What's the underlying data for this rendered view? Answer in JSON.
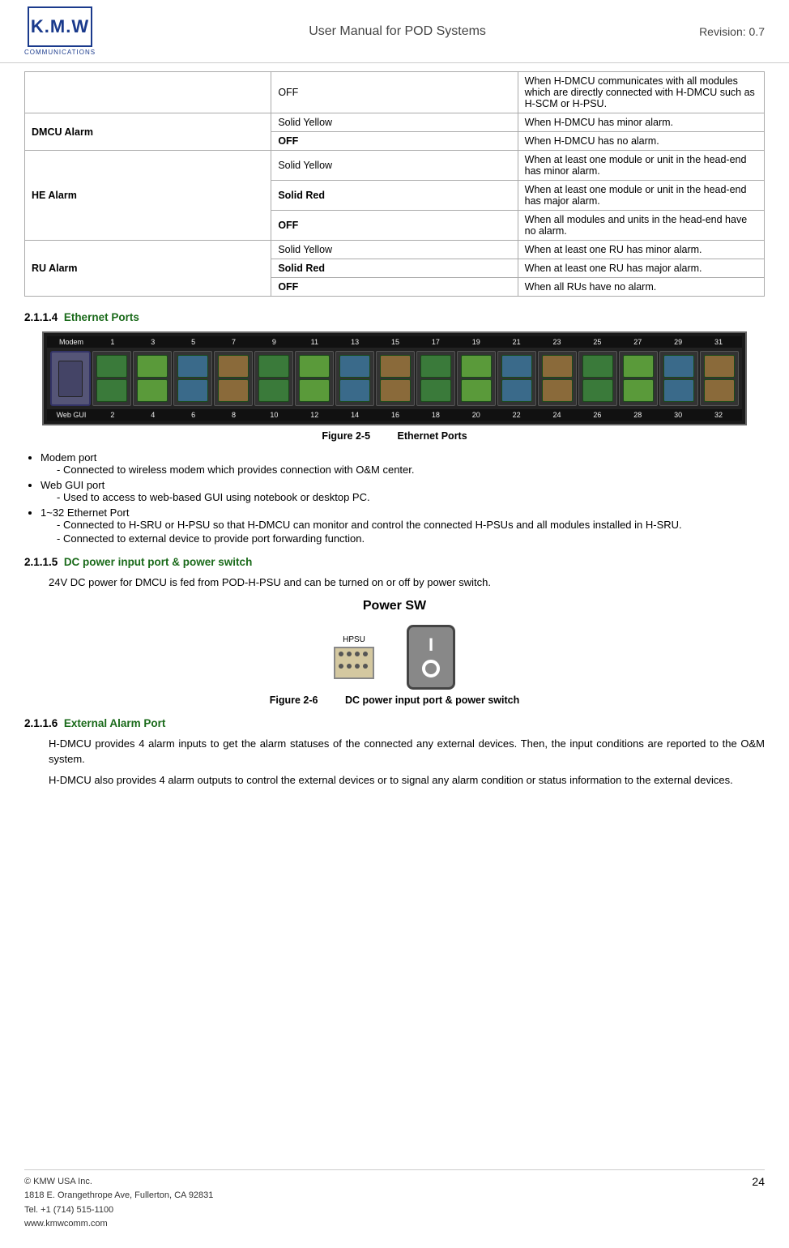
{
  "header": {
    "logo_line1": "K.M.W",
    "logo_subtitle": "COMMUNICATIONS",
    "title": "User Manual for POD Systems",
    "revision": "Revision: 0.7"
  },
  "table": {
    "rows": [
      {
        "group": "",
        "indicator": "OFF",
        "description": "When H-DMCU communicates with all modules which are directly connected with H-DMCU such as H-SCM or H-PSU."
      },
      {
        "group": "DMCU Alarm",
        "indicator": "Solid Yellow",
        "description": "When H-DMCU has minor alarm."
      },
      {
        "group": "",
        "indicator": "OFF",
        "description": "When H-DMCU has no alarm."
      },
      {
        "group": "HE Alarm",
        "indicator": "Solid Yellow",
        "description": "When at least one module or unit in the head-end has minor alarm."
      },
      {
        "group": "",
        "indicator": "Solid Red",
        "description": "When at least one module or unit in the head-end has major alarm."
      },
      {
        "group": "",
        "indicator": "OFF",
        "description": "When all modules and units in the head-end have no alarm."
      },
      {
        "group": "RU Alarm",
        "indicator": "Solid Yellow",
        "description": "When at least one RU has minor alarm."
      },
      {
        "group": "",
        "indicator": "Solid Red",
        "description": "When at least one RU has major alarm."
      },
      {
        "group": "",
        "indicator": "OFF",
        "description": "When all RUs have no alarm."
      }
    ]
  },
  "section_214": {
    "number": "2.1.1.4",
    "title": "Ethernet Ports",
    "figure_num": "Figure 2-5",
    "figure_title": "Ethernet Ports",
    "bullets": [
      {
        "main": "Modem port",
        "subs": [
          "Connected to wireless modem which provides connection with O&M center."
        ]
      },
      {
        "main": "Web GUI port",
        "subs": [
          "Used to access to web-based GUI using notebook or desktop PC."
        ]
      },
      {
        "main": "1~32 Ethernet Port",
        "subs": [
          "Connected to H-SRU or H-PSU so that H-DMCU can monitor and control the connected H-PSUs and all modules installed in H-SRU.",
          "Connected to external device to provide port forwarding function."
        ]
      }
    ]
  },
  "section_215": {
    "number": "2.1.1.5",
    "title": "DC power input port & power switch",
    "body": "24V DC power for DMCU is fed from POD-H-PSU and can be turned on or off by power switch.",
    "power_sw_label": "Power SW",
    "hpsu_label": "HPSU",
    "figure_num": "Figure 2-6",
    "figure_title": "DC power input port & power switch"
  },
  "section_216": {
    "number": "2.1.1.6",
    "title": "External Alarm Port",
    "body1": "H-DMCU provides 4 alarm inputs to get the alarm statuses of the connected any external devices. Then, the input conditions are reported to the O&M system.",
    "body2": "H-DMCU also provides 4 alarm outputs to control the external devices or to signal any alarm condition or status information to the external devices."
  },
  "footer": {
    "company": "© KMW USA Inc.",
    "address": "1818 E. Orangethrope Ave, Fullerton, CA 92831",
    "tel": "Tel. +1 (714) 515-1100",
    "web": "www.kmwcomm.com",
    "page": "24"
  },
  "eth_port_numbers_top": [
    "Modem",
    "1",
    "3",
    "5",
    "7",
    "9",
    "11",
    "13",
    "15",
    "17",
    "19",
    "21",
    "23",
    "25",
    "27",
    "29",
    "31"
  ],
  "eth_port_numbers_bottom": [
    "Web GUI",
    "2",
    "4",
    "6",
    "8",
    "10",
    "12",
    "14",
    "16",
    "18",
    "20",
    "22",
    "24",
    "26",
    "28",
    "30",
    "32"
  ]
}
